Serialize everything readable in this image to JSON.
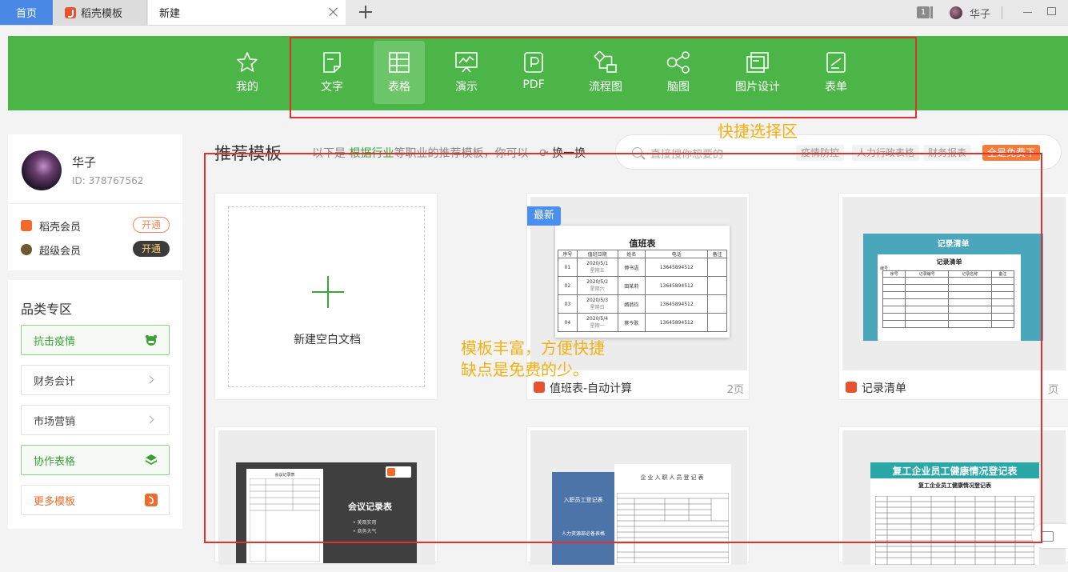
{
  "tabbar": {
    "tabs": [
      {
        "label": "首页"
      },
      {
        "label": "稻壳模板"
      },
      {
        "label": "新建"
      }
    ],
    "window_count": "1",
    "user": "华子"
  },
  "categories": [
    {
      "label": "我的",
      "icon": "star-icon"
    },
    {
      "label": "文字",
      "icon": "document-icon"
    },
    {
      "label": "表格",
      "icon": "table-icon"
    },
    {
      "label": "演示",
      "icon": "presentation-icon"
    },
    {
      "label": "PDF",
      "icon": "pdf-icon"
    },
    {
      "label": "流程图",
      "icon": "flowchart-icon"
    },
    {
      "label": "脑图",
      "icon": "mindmap-icon"
    },
    {
      "label": "图片设计",
      "icon": "image-design-icon"
    },
    {
      "label": "表单",
      "icon": "form-icon"
    }
  ],
  "active_category": "表格",
  "annotations": {
    "quick_select": "快捷选择区",
    "templates_line1": "模板丰富，方便快捷",
    "templates_line2": "缺点是免费的少。"
  },
  "profile": {
    "name": "华子",
    "id": "ID: 378767562",
    "memberships": [
      {
        "label": "稻壳会员",
        "button": "开通"
      },
      {
        "label": "超级会员",
        "button": "开通"
      }
    ]
  },
  "category_zone": {
    "title": "品类专区",
    "items": [
      {
        "label": "抗击疫情"
      },
      {
        "label": "财务会计"
      },
      {
        "label": "市场营销"
      },
      {
        "label": "协作表格"
      },
      {
        "label": "更多模板"
      }
    ]
  },
  "main": {
    "title": "推荐模板",
    "subtitle_prefix": "以下是",
    "subtitle_link": "根据行业",
    "subtitle_suffix": "等职业的推荐模板，你可以",
    "refresh": "换一换",
    "search_placeholder": "直接搜你想要的",
    "search_tags": [
      "疫情防控",
      "人力行政表格",
      "财务报表"
    ],
    "search_promo": "全是免费下"
  },
  "cards": {
    "blank": {
      "label": "新建空白文档"
    },
    "duty": {
      "badge": "最新",
      "name": "值班表-自动计算",
      "pages": "2页",
      "thumb_title": "值班表",
      "headers": [
        "序号",
        "值班日期",
        "姓名",
        "电话",
        "备注"
      ],
      "rows": [
        {
          "no": "01",
          "date": "2020/5/1",
          "weekday": "星期五",
          "name": "傅书语",
          "phone": "13645894512"
        },
        {
          "no": "02",
          "date": "2020/5/2",
          "weekday": "星期六",
          "name": "田某莉",
          "phone": "13645894512"
        },
        {
          "no": "03",
          "date": "2020/5/3",
          "weekday": "星期日",
          "name": "嫣翁钧",
          "phone": "13645894512"
        },
        {
          "no": "04",
          "date": "2020/5/4",
          "weekday": "星期一",
          "name": "蔡今歌",
          "phone": "13645894512"
        }
      ]
    },
    "record": {
      "name": "记录清单",
      "pages": "页",
      "thumb_banner": "记录清单",
      "thumb_title": "记录清单",
      "thumb_label": "编号：",
      "headers": [
        "序号",
        "记录编号",
        "记录名称",
        "备注"
      ]
    },
    "meeting": {
      "thumb_title": "会议记录表",
      "paper_title": "会议记录表",
      "bullets": [
        "美观实用",
        "商务大气"
      ]
    },
    "onboard": {
      "left_title": "入职员工登记表",
      "left_sub": "人力资源部必备表格",
      "paper_title": "企业入职人员登记表"
    },
    "health": {
      "banner": "复工企业员工健康情况登记表",
      "paper_title": "复工企业员工健康情况登记表"
    }
  },
  "colors": {
    "green": "#4cb548",
    "accent_blue": "#4a88e6",
    "annotation": "#f2b015",
    "annotation_box": "#e03131",
    "orange": "#f47b3a"
  }
}
